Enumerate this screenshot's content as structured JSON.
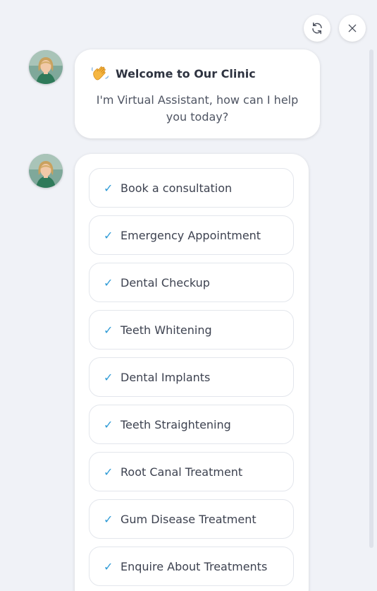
{
  "header": {
    "refresh_icon": "refresh-icon",
    "close_icon": "close-icon"
  },
  "assistant": {
    "avatar_icon": "avatar-woman"
  },
  "welcome": {
    "emoji_icon": "waving-hand-icon",
    "title": "Welcome to Our Clinic",
    "message": "I'm Virtual Assistant, how can I help you today?"
  },
  "options": {
    "check_glyph": "✓",
    "items": [
      {
        "label": "Book a consultation"
      },
      {
        "label": "Emergency Appointment"
      },
      {
        "label": "Dental Checkup"
      },
      {
        "label": "Teeth Whitening"
      },
      {
        "label": "Dental Implants"
      },
      {
        "label": "Teeth Straightening"
      },
      {
        "label": "Root Canal Treatment"
      },
      {
        "label": "Gum Disease Treatment"
      },
      {
        "label": "Enquire About Treatments"
      }
    ]
  },
  "colors": {
    "background": "#f0f2f7",
    "check_accent": "#2f9bd6",
    "bubble": "#ffffff"
  }
}
